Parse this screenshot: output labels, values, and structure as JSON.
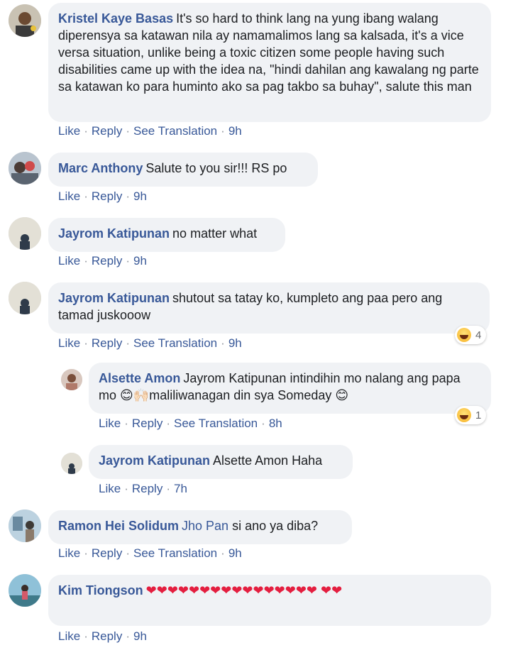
{
  "labels": {
    "like": "Like",
    "reply": "Reply",
    "see_translation": "See Translation"
  },
  "comments": [
    {
      "author": "Kristel Kaye Basas",
      "text": "It's so hard to think lang na yung ibang walang diperensya sa katawan nila ay namamalimos lang sa kalsada, it's a vice versa situation, unlike being a toxic citizen some people having such disabilities came up with the idea na, \"hindi dahilan ang kawalang ng parte sa katawan ko para huminto ako sa pag takbo sa buhay\", salute this man",
      "time": "9h"
    },
    {
      "author": "Marc Anthony",
      "text": "Salute to you sir!!! RS po",
      "time": "9h"
    },
    {
      "author": "Jayrom Katipunan",
      "text": "no matter what",
      "time": "9h"
    },
    {
      "author": "Jayrom Katipunan",
      "text": "shutout sa tatay ko, kumpleto ang paa pero ang tamad juskooow",
      "time": "9h",
      "reaction_count": "4"
    },
    {
      "author": "Alsette Amon",
      "text_1": "Jayrom Katipunan intindihin mo nalang ang papa mo ",
      "emoji_1": "😊",
      "emoji_2": "🙌🏻",
      "text_2": "maliliwanagan din sya Someday ",
      "emoji_3": "😊",
      "time": "8h",
      "reaction_count": "1"
    },
    {
      "author": "Jayrom Katipunan",
      "text": "Alsette Amon Haha",
      "time": "7h"
    },
    {
      "author": "Ramon Hei Solidum",
      "mention": "Jho Pan",
      "text": " si ano ya diba?",
      "time": "9h"
    },
    {
      "author": "Kim Tiongson",
      "text": "❤❤❤❤❤❤❤❤❤❤❤❤❤❤❤❤ ❤❤",
      "time": "9h"
    }
  ],
  "colors": {
    "link": "#385898",
    "bubble": "#f0f2f5",
    "heart": "#e41e3f"
  }
}
